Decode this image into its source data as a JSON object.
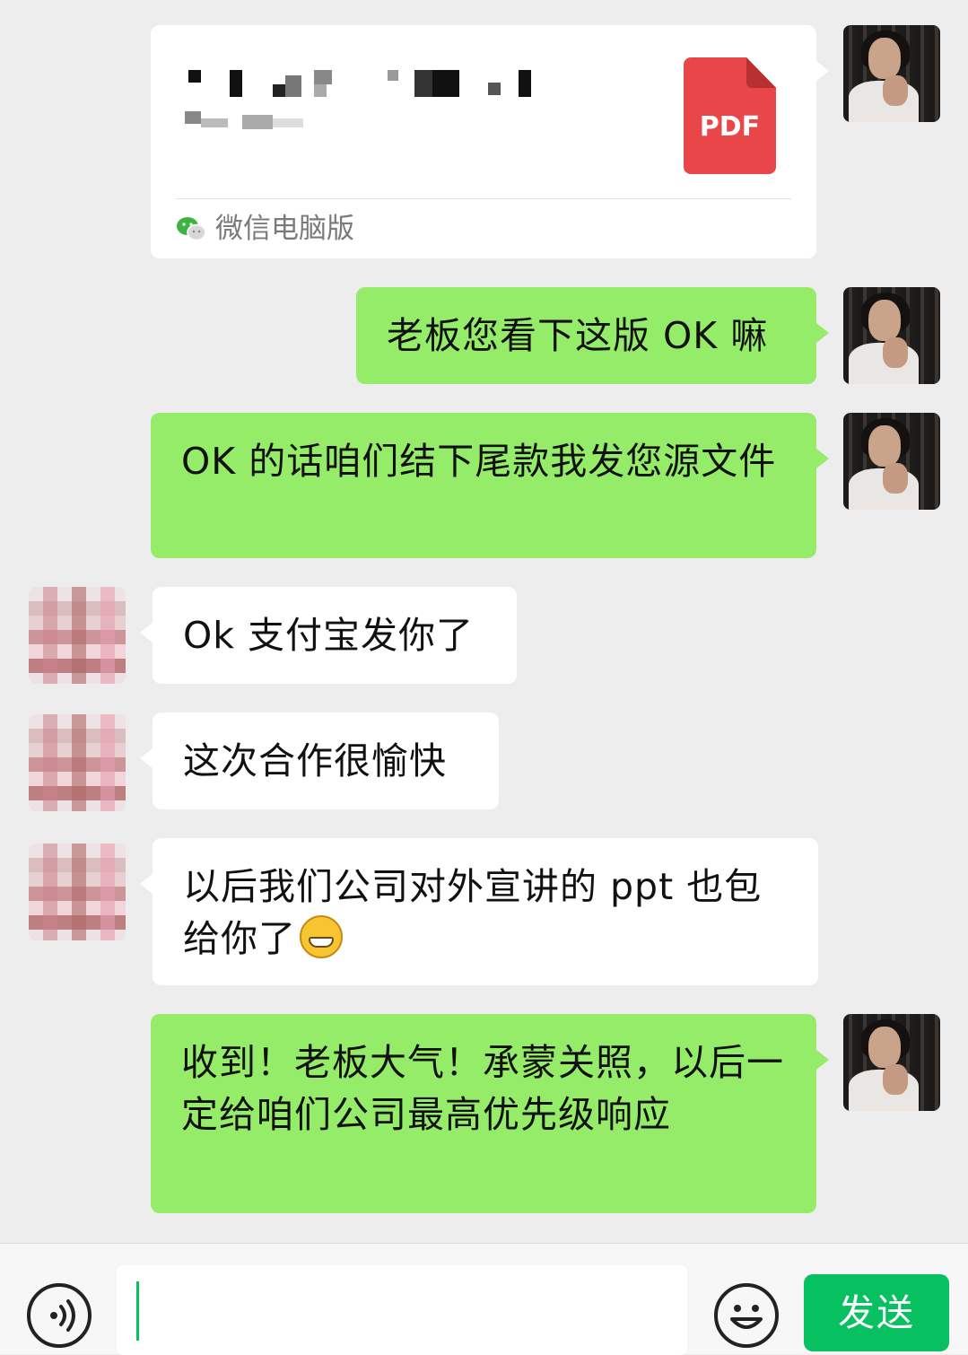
{
  "file_card": {
    "source": "微信电脑版",
    "file_type": "PDF"
  },
  "messages": [
    {
      "side": "right",
      "text": "老板您看下这版 OK 嘛"
    },
    {
      "side": "right",
      "text": "OK 的话咱们结下尾款我发您源文件"
    },
    {
      "side": "left",
      "text": "Ok 支付宝发你了"
    },
    {
      "side": "left",
      "text": "这次合作很愉快"
    },
    {
      "side": "left",
      "text": "以后我们公司对外宣讲的 ppt 也包给你了"
    },
    {
      "side": "right",
      "text": "收到！老板大气！承蒙关照，以后一定给咱们公司最高优先级响应"
    }
  ],
  "input_bar": {
    "send_label": "发送",
    "voice_icon": "voice-icon",
    "emoji_icon": "emoji-icon"
  },
  "colors": {
    "sent_bubble": "#95ec69",
    "received_bubble": "#ffffff",
    "background": "#ededed",
    "accent": "#07c160",
    "pdf": "#e9464a"
  }
}
